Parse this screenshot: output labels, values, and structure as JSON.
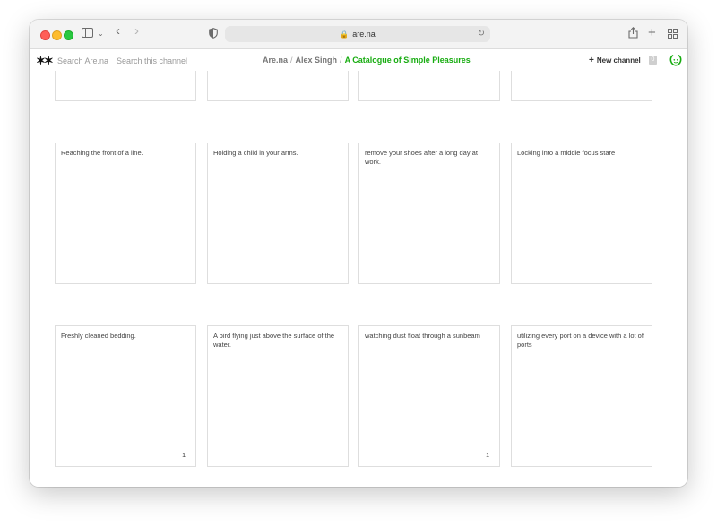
{
  "browser": {
    "url": "are.na"
  },
  "app": {
    "logo": "✶✶",
    "search_arena_placeholder": "Search Are.na",
    "search_channel_placeholder": "Search this channel",
    "breadcrumb": {
      "root": "Are.na",
      "user": "Alex Singh",
      "channel": "A Catalogue of Simple Pleasures",
      "separator": "/"
    },
    "new_channel_label": "New channel",
    "notification_count": "0",
    "accent_color": "#17ac10"
  },
  "blocks_row_1": [
    {
      "text": "Reaching the front of a line.",
      "count": ""
    },
    {
      "text": "Holding a child in your arms.",
      "count": ""
    },
    {
      "text": "remove your shoes after a long day at work.",
      "count": ""
    },
    {
      "text": "Locking into a middle focus stare",
      "count": ""
    }
  ],
  "blocks_row_2": [
    {
      "text": "Freshly cleaned bedding.",
      "count": "1"
    },
    {
      "text": "A bird flying just above the surface of the water.",
      "count": ""
    },
    {
      "text": "watching dust float through a sunbeam",
      "count": "1"
    },
    {
      "text": "utilizing every port on a device with a lot of ports",
      "count": ""
    }
  ]
}
